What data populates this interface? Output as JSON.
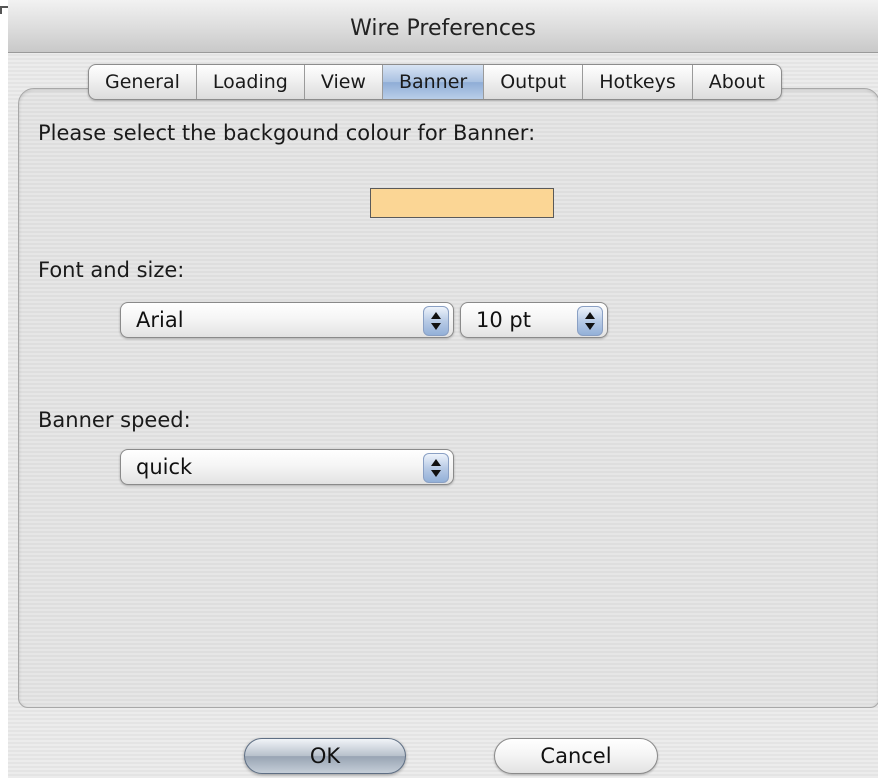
{
  "window": {
    "title": "Wire Preferences"
  },
  "tabs": [
    {
      "label": "General",
      "selected": false
    },
    {
      "label": "Loading",
      "selected": false
    },
    {
      "label": "View",
      "selected": false
    },
    {
      "label": "Banner",
      "selected": true
    },
    {
      "label": "Output",
      "selected": false
    },
    {
      "label": "Hotkeys",
      "selected": false
    },
    {
      "label": "About",
      "selected": false
    }
  ],
  "banner": {
    "color_prompt": "Please select the backgound colour for Banner:",
    "swatch_color": "#fbd695",
    "font_label": "Font and size:",
    "font_value": "Arial",
    "size_value": "10 pt",
    "speed_label": "Banner speed:",
    "speed_value": "quick"
  },
  "buttons": {
    "ok": "OK",
    "cancel": "Cancel"
  },
  "colors": {
    "selected_tab": "#a9c1e1",
    "swatch": "#fbd695"
  }
}
